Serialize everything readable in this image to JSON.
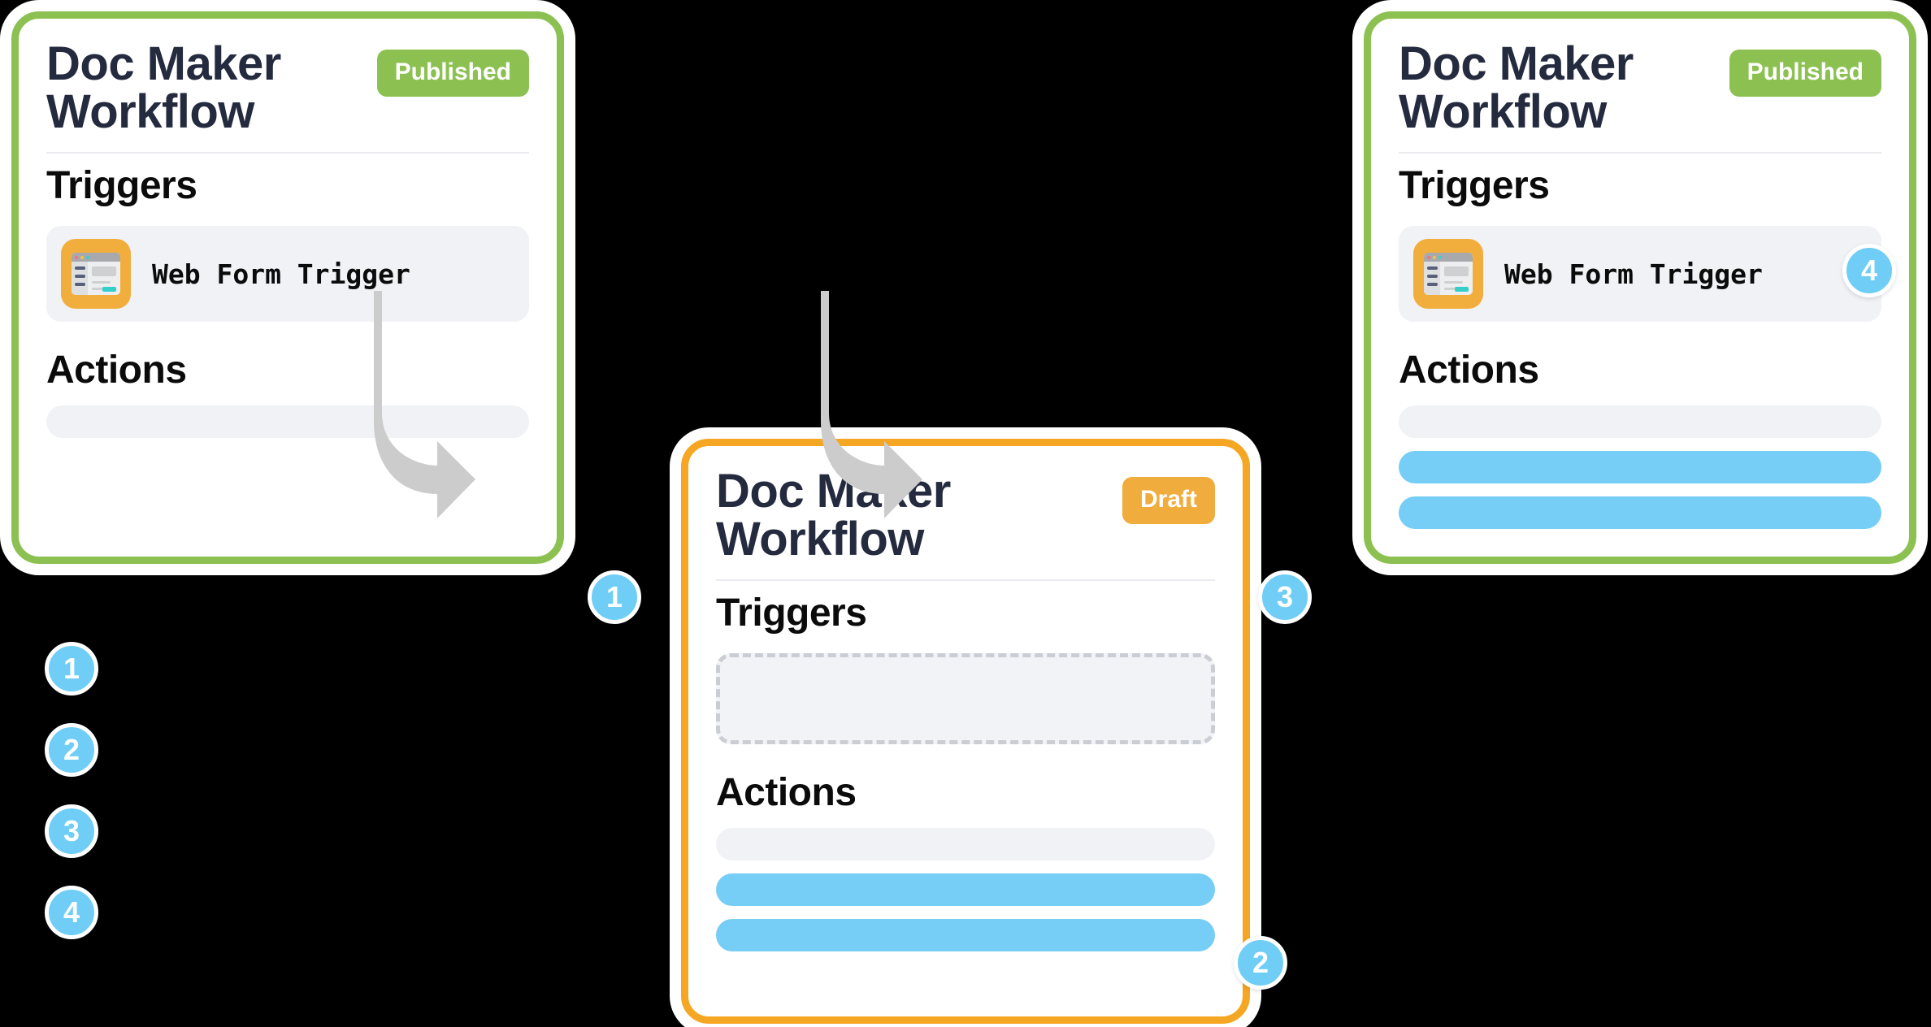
{
  "cards": [
    {
      "id": "published-before",
      "title": "Doc Maker Workflow",
      "status_label": "Published",
      "status_type": "published",
      "triggers_label": "Triggers",
      "actions_label": "Actions",
      "trigger_name": "Web Form Trigger",
      "trigger_icon": "web-form-icon",
      "trigger_badge": null,
      "action_bars": [
        "gray"
      ]
    },
    {
      "id": "draft-editing",
      "title": "Doc Maker Workflow",
      "status_label": "Draft",
      "status_type": "draft",
      "triggers_label": "Triggers",
      "actions_label": "Actions",
      "trigger_name": "",
      "trigger_icon": "empty-placeholder",
      "trigger_badge": null,
      "action_bars": [
        "gray",
        "blue",
        "blue"
      ]
    },
    {
      "id": "published-after",
      "title": "Doc Maker Workflow",
      "status_label": "Published",
      "status_type": "published",
      "triggers_label": "Triggers",
      "actions_label": "Actions",
      "trigger_name": "Web Form Trigger",
      "trigger_icon": "web-form-icon",
      "trigger_badge": "4",
      "action_bars": [
        "gray",
        "blue",
        "blue"
      ]
    }
  ],
  "steps": {
    "between_left_middle": "1",
    "on_middle_actions": "2",
    "between_middle_right": "3",
    "on_right_trigger": "4"
  },
  "legend": [
    "1",
    "2",
    "3",
    "4"
  ],
  "colors": {
    "published_green": "#8CC152",
    "draft_orange": "#F0AD3E",
    "step_blue": "#6FCDF6",
    "action_blue": "#76CDF5",
    "title_navy": "#252B3F",
    "row_gray": "#F0F2F6",
    "arrow_gray": "#CCCCCC",
    "background": "#000000"
  }
}
